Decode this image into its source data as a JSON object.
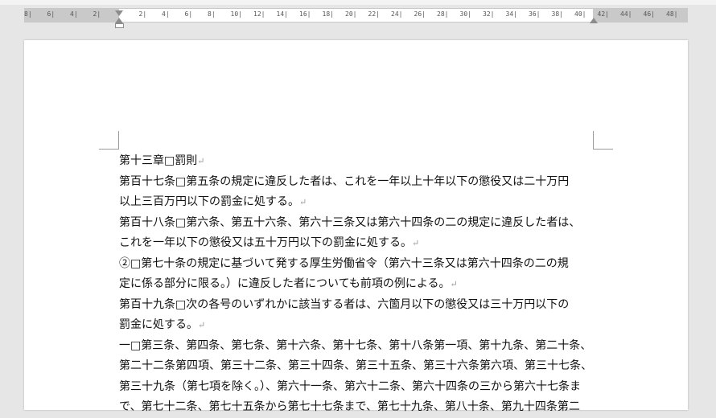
{
  "document": {
    "lines": [
      "第十三章□罰則",
      "第百十七条□第五条の規定に違反した者は、これを一年以上十年以下の懲役又は二十万円",
      "以上三百万円以下の罰金に処する。",
      "第百十八条□第六条、第五十六条、第六十三条又は第六十四条の二の規定に違反した者は、",
      "これを一年以下の懲役又は五十万円以下の罰金に処する。",
      "②□第七十条の規定に基づいて発する厚生労働省令（第六十三条又は第六十四条の二の規",
      "定に係る部分に限る。）に違反した者についても前項の例による。",
      "第百十九条□次の各号のいずれかに該当する者は、六箇月以下の懲役又は三十万円以下の",
      "罰金に処する。",
      "一□第三条、第四条、第七条、第十六条、第十七条、第十八条第一項、第十九条、第二十条、",
      "第二十二条第四項、第三十二条、第三十四条、第三十五条、第三十六条第六項、第三十七条、",
      "第三十九条（第七項を除く。）、第六十一条、第六十二条、第六十四条の三から第六十七条ま",
      "で、第七十二条、第七十五条から第七十七条まで、第七十九条、第八十条、第九十四条第二"
    ],
    "paragraph_mark": "↵"
  },
  "ruler": {
    "ticks": [
      "8",
      "6",
      "4",
      "2",
      "",
      "2",
      "4",
      "6",
      "8",
      "10",
      "12",
      "14",
      "16",
      "18",
      "20",
      "22",
      "24",
      "26",
      "28",
      "30",
      "32",
      "34",
      "36",
      "38",
      "40",
      "42",
      "44",
      "46",
      "48"
    ]
  }
}
